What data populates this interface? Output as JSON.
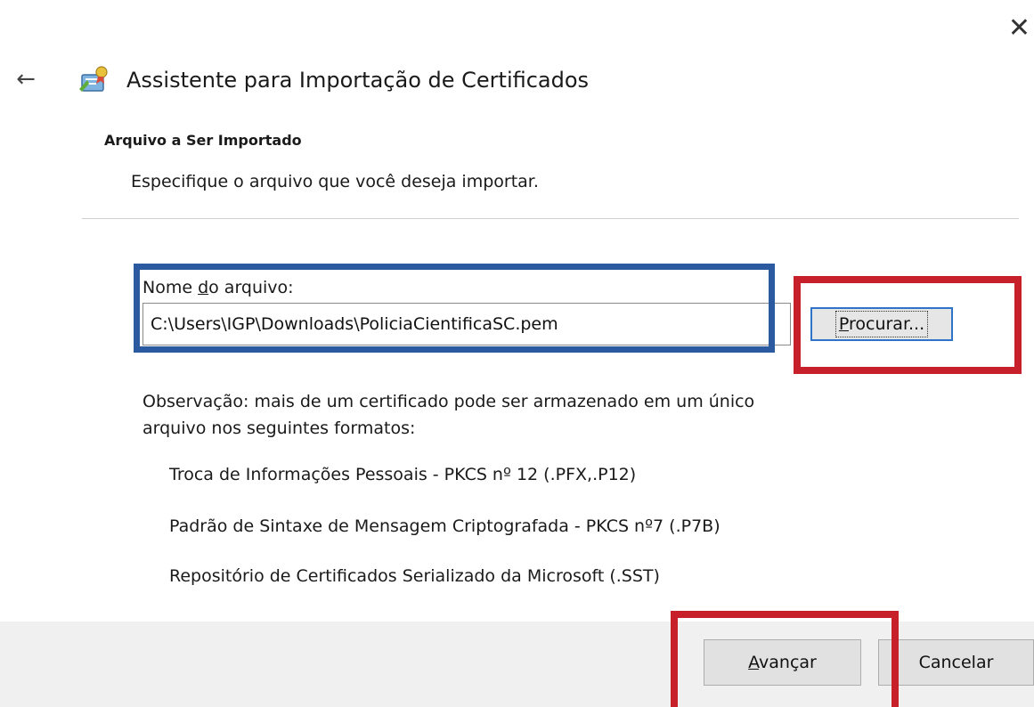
{
  "window": {
    "close_glyph": "✕",
    "back_glyph": "←",
    "title": "Assistente para Importação de Certificados",
    "icon": "certificate-wizard-icon"
  },
  "header": {
    "heading": "Arquivo a Ser Importado",
    "subtitle": "Especifique o arquivo que você deseja importar."
  },
  "file": {
    "label_pre": "Nome ",
    "label_accel": "d",
    "label_post": "o arquivo:",
    "value": "C:\\Users\\IGP\\Downloads\\PoliciaCientificaSC.pem",
    "browse_accel": "P",
    "browse_rest": "rocurar..."
  },
  "note": {
    "text": "Observação: mais de um certificado pode ser armazenado em um único arquivo nos seguintes formatos:",
    "formats": [
      "Troca de Informações Pessoais - PKCS nº 12 (.PFX,.P12)",
      "Padrão de Sintaxe de Mensagem Criptografada - PKCS nº7 (.P7B)",
      "Repositório de Certificados Serializado da Microsoft (.SST)"
    ]
  },
  "footer": {
    "next_accel": "A",
    "next_rest": "vançar",
    "cancel_label": "Cancelar"
  },
  "colors": {
    "highlight_blue": "#2c5aa0",
    "highlight_red": "#c8202a",
    "focus_border": "#2f74c9",
    "footer_bg": "#f0f0f0"
  }
}
